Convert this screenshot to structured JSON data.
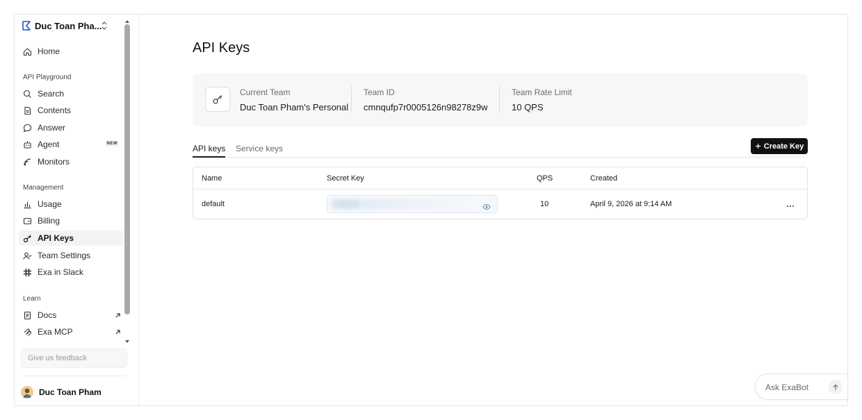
{
  "workspace": {
    "name": "Duc Toan Pha..."
  },
  "sidebar": {
    "home": "Home",
    "sections": {
      "playground": "API Playground",
      "management": "Management",
      "learn": "Learn"
    },
    "playground_items": [
      {
        "label": "Search",
        "icon": "search-icon"
      },
      {
        "label": "Contents",
        "icon": "document-icon"
      },
      {
        "label": "Answer",
        "icon": "chat-icon"
      },
      {
        "label": "Agent",
        "icon": "robot-icon",
        "badge": "NEW"
      },
      {
        "label": "Monitors",
        "icon": "monitor-icon"
      }
    ],
    "management_items": [
      {
        "label": "Usage",
        "icon": "bar-chart-icon"
      },
      {
        "label": "Billing",
        "icon": "billing-icon"
      },
      {
        "label": "API Keys",
        "icon": "key-icon",
        "active": true
      },
      {
        "label": "Team Settings",
        "icon": "team-icon"
      },
      {
        "label": "Exa in Slack",
        "icon": "slack-icon"
      }
    ],
    "learn_items": [
      {
        "label": "Docs",
        "icon": "docs-icon"
      },
      {
        "label": "Exa MCP",
        "icon": "mcp-icon"
      }
    ],
    "feedback_placeholder": "Give us feedback",
    "user_name": "Duc Toan Pham"
  },
  "main": {
    "title": "API Keys",
    "team_card": {
      "current_team_label": "Current Team",
      "current_team_value": "Duc Toan Pham's Personal",
      "team_id_label": "Team ID",
      "team_id_value": "cmnqufp7r0005126n98278z9w",
      "rate_limit_label": "Team Rate Limit",
      "rate_limit_value": "10 QPS"
    },
    "tabs": [
      "API keys",
      "Service keys"
    ],
    "create_button": "Create Key",
    "table": {
      "headers": [
        "Name",
        "Secret Key",
        "QPS",
        "Created"
      ],
      "rows": [
        {
          "name": "default",
          "secret": "",
          "qps": "10",
          "created": "April 9, 2026 at 9:14 AM"
        }
      ]
    }
  },
  "ask": {
    "placeholder": "Ask ExaBot"
  },
  "colors": {
    "accent": "#111111",
    "active_bg": "#f3f3f3",
    "card_bg": "#f7f7f7"
  }
}
